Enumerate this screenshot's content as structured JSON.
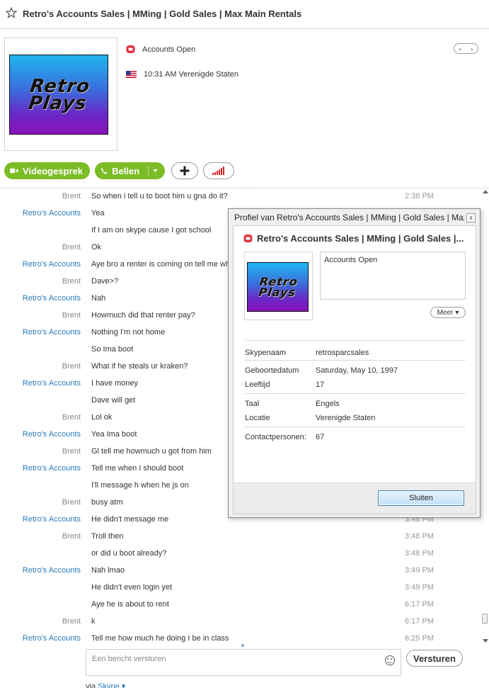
{
  "header": {
    "title": "Retro's Accounts Sales | MMing | Gold Sales | Max Main Rentals"
  },
  "profile": {
    "status": "Accounts Open",
    "local_time": "10:31 AM Verenigde Staten",
    "logo_text": "Retro Plays"
  },
  "actions": {
    "video_label": "Videogesprek",
    "call_label": "Bellen",
    "more_dots": "..."
  },
  "messages": [
    {
      "sender": "Brent",
      "text": "So when i tell u to boot him u gna do it?",
      "time": "2:38 PM"
    },
    {
      "sender": "Retro's Accounts",
      "text": "Yea",
      "time": ""
    },
    {
      "sender": "",
      "text": "If I am on skype cause I got school",
      "time": ""
    },
    {
      "sender": "Brent",
      "text": "Ok",
      "time": ""
    },
    {
      "sender": "Retro's Accounts",
      "text": "Aye bro a renter is coming on tell me wha",
      "time": ""
    },
    {
      "sender": "Brent",
      "text": "Dave>?",
      "time": ""
    },
    {
      "sender": "Retro's Accounts",
      "text": "Nah",
      "time": ""
    },
    {
      "sender": "Brent",
      "text": "Howmuch did that renter pay?",
      "time": ""
    },
    {
      "sender": "Retro's Accounts",
      "text": "Nothing I'm not home",
      "time": ""
    },
    {
      "sender": "",
      "text": "So Ima boot",
      "time": ""
    },
    {
      "sender": "Brent",
      "text": "What if he steals ur kraken?",
      "time": ""
    },
    {
      "sender": "Retro's Accounts",
      "text": "I have money",
      "time": ""
    },
    {
      "sender": "",
      "text": "Dave will get",
      "time": ""
    },
    {
      "sender": "Brent",
      "text": "Lol ok",
      "time": ""
    },
    {
      "sender": "Retro's Accounts",
      "text": "Yea Ima boot",
      "time": ""
    },
    {
      "sender": "Brent",
      "text": "Gl tell me howmuch u got from him",
      "time": ""
    },
    {
      "sender": "Retro's Accounts",
      "text": "Tell me when I should boot",
      "time": ""
    },
    {
      "sender": "",
      "text": "I'll message h when he js on",
      "time": ""
    },
    {
      "sender": "Brent",
      "text": "busy atm",
      "time": ""
    },
    {
      "sender": "Retro's Accounts",
      "text": "He didn't message me",
      "time": "3:48 PM"
    },
    {
      "sender": "Brent",
      "text": "Troll then",
      "time": "3:48 PM"
    },
    {
      "sender": "",
      "text": "or did u boot already?",
      "time": "3:48 PM"
    },
    {
      "sender": "Retro's Accounts",
      "text": "Nah lmao",
      "time": "3:49 PM"
    },
    {
      "sender": "",
      "text": "He didn't even login yet",
      "time": "3:49 PM"
    },
    {
      "sender": "",
      "text": "Aye he is about to rent",
      "time": "6:17 PM"
    },
    {
      "sender": "Brent",
      "text": "k",
      "time": "6:17 PM"
    },
    {
      "sender": "Retro's Accounts",
      "text": "Tell me how much he doing I be in class",
      "time": "6:25 PM"
    }
  ],
  "composer": {
    "placeholder": "Een bericht versturen",
    "send_label": "Versturen",
    "via_prefix": "via",
    "via_link": "Skype"
  },
  "dialog": {
    "window_title": "Profiel van Retro's Accounts Sales | MMing | Gold Sales | Max Main Rentals",
    "close_x": "x",
    "name": "Retro's Accounts Sales | MMing | Gold Sales |...",
    "mood": "Accounts Open",
    "more_label": "Meer",
    "fields": {
      "skypename_label": "Skypenaam",
      "skypename_value": "retrosparcsales",
      "birthdate_label": "Geboortedatum",
      "birthdate_value": "Saturday, May 10, 1997",
      "age_label": "Leeftijd",
      "age_value": "17",
      "language_label": "Taal",
      "language_value": "Engels",
      "location_label": "Locatie",
      "location_value": "Verenigde Staten",
      "contacts_label": "Contactpersonen:",
      "contacts_value": "67"
    },
    "close_button": "Sluiten"
  },
  "colors": {
    "accent_green": "#7cbc26",
    "link_blue": "#2a7ab8",
    "skype_red": "#e0333f"
  }
}
